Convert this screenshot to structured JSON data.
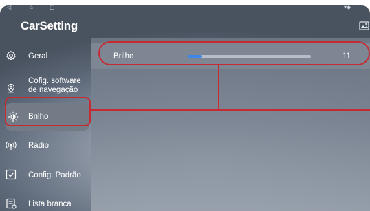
{
  "app": {
    "title": "CarSetting"
  },
  "sidebar": {
    "items": [
      {
        "label": "Geral",
        "icon": "gear-icon"
      },
      {
        "label": "Cofig. software",
        "label2": "de navegação",
        "icon": "location-pin-icon"
      },
      {
        "label": "Brilho",
        "icon": "sun-icon",
        "active": true
      },
      {
        "label": "Rádio",
        "icon": "radio-signal-icon"
      },
      {
        "label": "Config. Padrão",
        "icon": "checkbox-icon"
      },
      {
        "label": "Lista branca",
        "icon": "list-icon"
      }
    ]
  },
  "brightness": {
    "label": "Brilho",
    "value": "11",
    "level_fraction": 0.11
  },
  "colors": {
    "highlight": "#c62a32",
    "slider_accent": "#3f87e6"
  }
}
